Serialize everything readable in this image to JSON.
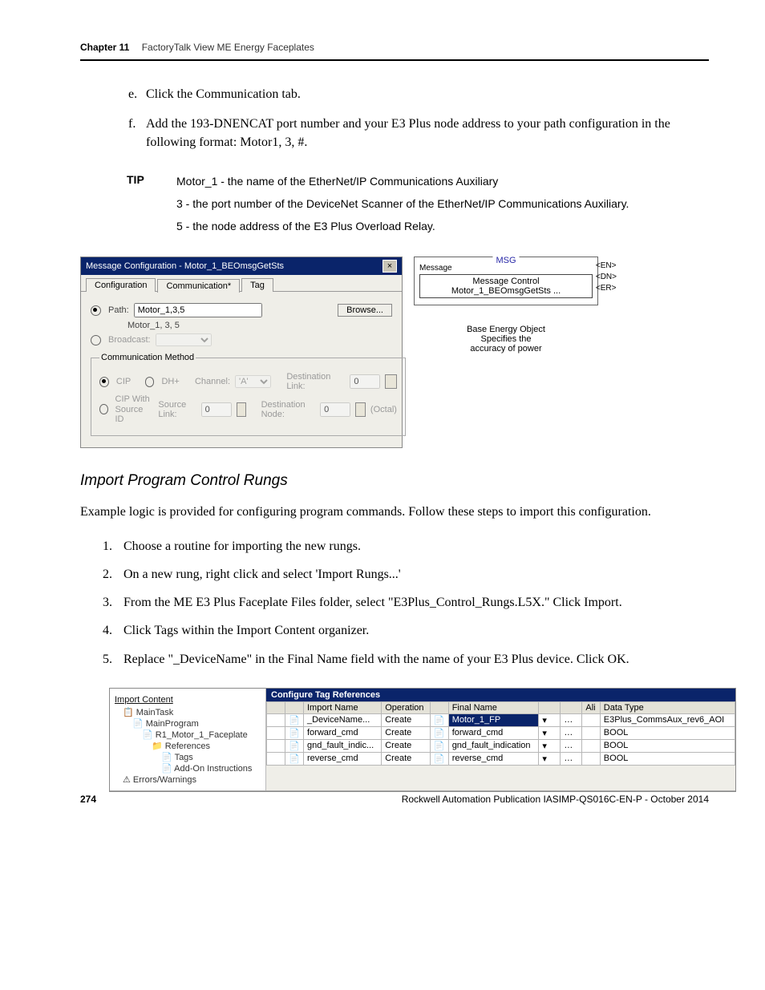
{
  "header": {
    "chapnum": "Chapter 11",
    "chapter": "FactoryTalk View ME Energy Faceplates"
  },
  "steps_e": {
    "marker": "e.",
    "text": "Click the Communication tab."
  },
  "steps_f": {
    "marker": "f.",
    "text": "Add the 193-DNENCAT port number and your E3 Plus node address to your path configuration in the following format: Motor1, 3, #."
  },
  "tip": {
    "label": "TIP",
    "l1": "Motor_1 - the name of the EtherNet/IP Communications Auxiliary",
    "l2": "3 - the port number of the DeviceNet Scanner of the EtherNet/IP Communications Auxiliary.",
    "l3": "5 - the node address of the E3 Plus Overload Relay."
  },
  "dlg": {
    "title": "Message Configuration - Motor_1_BEOmsgGetSts",
    "tabs": {
      "t1": "Configuration",
      "t2": "Communication*",
      "t3": "Tag"
    },
    "path_label": "Path:",
    "path_value": "Motor_1,3,5",
    "path_echo": "Motor_1, 3, 5",
    "browse": "Browse...",
    "broadcast": "Broadcast:",
    "cm_legend": "Communication Method",
    "cip": "CIP",
    "dhp": "DH+",
    "channel": "Channel:",
    "chan_val": "'A'",
    "dest_link": "Destination Link:",
    "dest_link_val": "0",
    "cipsrc": "CIP With Source ID",
    "src_link": "Source Link:",
    "src_link_val": "0",
    "dest_node": "Destination Node:",
    "dest_node_val": "0",
    "octal": "(Octal)"
  },
  "msg": {
    "label": "MSG",
    "msg_ctrl": "Message",
    "tag": "Message Control  Motor_1_BEOmsgGetSts  ...",
    "pins": {
      "en": "EN",
      "dn": "DN",
      "er": "ER"
    },
    "desc1": "Base Energy Object",
    "desc2": "Specifies the",
    "desc3": "accuracy of power"
  },
  "section": "Import Program Control Rungs",
  "lede": "Example logic is provided for configuring program commands. Follow these steps to import this configuration.",
  "num": {
    "s1": "Choose a routine for importing the new rungs.",
    "s2": "On a new rung, right click and select 'Import Rungs...'",
    "s3": "From the ME E3 Plus Faceplate Files folder, select \"E3Plus_Control_Rungs.L5X.\" Click Import.",
    "s4": "Click Tags within the Import Content organizer.",
    "s5": "Replace \"_DeviceName\" in the Final Name field with the name of your E3 Plus device. Click OK."
  },
  "import_fig": {
    "tree_hdr": "Import Content",
    "tree": {
      "maintask": "MainTask",
      "mainprog": "MainProgram",
      "routine": "R1_Motor_1_Faceplate",
      "refs": "References",
      "tags": "Tags",
      "aoi": "Add-On Instructions",
      "err": "Errors/Warnings"
    },
    "grid_title": "Configure Tag References",
    "cols": {
      "imp": "Import Name",
      "op": "Operation",
      "fin": "Final Name",
      "ali": "Ali",
      "dt": "Data Type"
    },
    "rows": [
      {
        "imp": "_DeviceName...",
        "op": "Create",
        "fin": "Motor_1_FP",
        "dt": "E3Plus_CommsAux_rev6_AOI",
        "sel": true
      },
      {
        "imp": "forward_cmd",
        "op": "Create",
        "fin": "forward_cmd",
        "dt": "BOOL"
      },
      {
        "imp": "gnd_fault_indic...",
        "op": "Create",
        "fin": "gnd_fault_indication",
        "dt": "BOOL"
      },
      {
        "imp": "reverse_cmd",
        "op": "Create",
        "fin": "reverse_cmd",
        "dt": "BOOL"
      }
    ]
  },
  "footer": {
    "page": "274",
    "pub": "Rockwell Automation Publication IASIMP-QS016C-EN-P - October 2014"
  }
}
